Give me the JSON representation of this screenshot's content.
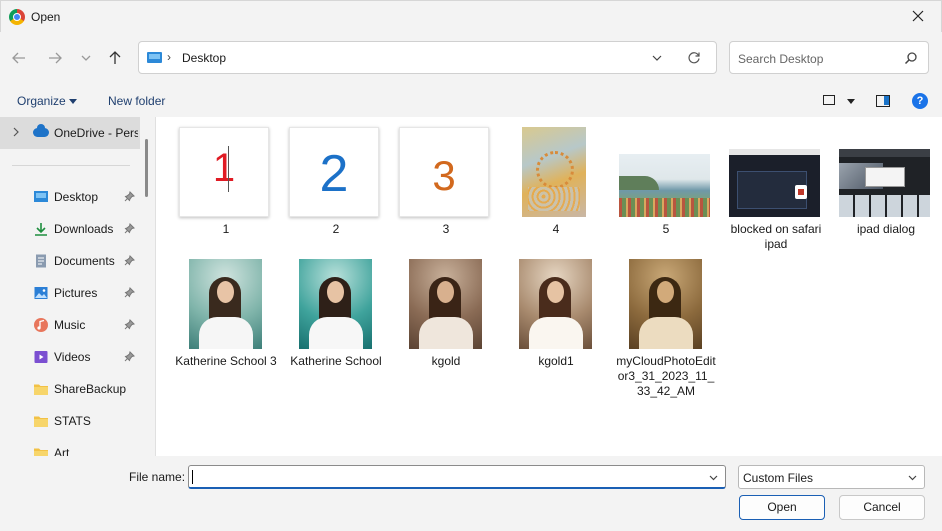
{
  "window": {
    "title": "Open"
  },
  "address": {
    "path": "Desktop"
  },
  "search": {
    "placeholder": "Search Desktop"
  },
  "commandbar": {
    "organize": "Organize",
    "new_folder": "New folder"
  },
  "sidebar": {
    "onedrive": "OneDrive - Perso",
    "items": [
      {
        "label": "Desktop",
        "icon": "desktop-icon"
      },
      {
        "label": "Downloads",
        "icon": "downloads-icon"
      },
      {
        "label": "Documents",
        "icon": "documents-icon"
      },
      {
        "label": "Pictures",
        "icon": "pictures-icon"
      },
      {
        "label": "Music",
        "icon": "music-icon"
      },
      {
        "label": "Videos",
        "icon": "videos-icon"
      },
      {
        "label": "ShareBackup",
        "icon": "folder-icon"
      },
      {
        "label": "STATS",
        "icon": "folder-icon"
      },
      {
        "label": "Art",
        "icon": "folder-icon"
      }
    ]
  },
  "files": {
    "row1": [
      {
        "name": "1",
        "glyph": "1",
        "color": "#e01b24"
      },
      {
        "name": "2",
        "glyph": "2",
        "color": "#1c71c8"
      },
      {
        "name": "3",
        "glyph": "3",
        "color": "#d2691e"
      },
      {
        "name": "4"
      },
      {
        "name": "5"
      },
      {
        "name": "blocked on safari ipad"
      },
      {
        "name": "ipad dialog"
      }
    ],
    "row2": [
      {
        "name": "Katherine School 3"
      },
      {
        "name": "Katherine School"
      },
      {
        "name": "kgold"
      },
      {
        "name": "kgold1"
      },
      {
        "name": "myCloudPhotoEditor3_31_2023_11_33_42_AM"
      }
    ]
  },
  "footer": {
    "file_name_label": "File name:",
    "file_name_value": "",
    "file_type": "Custom Files",
    "open": "Open",
    "cancel": "Cancel"
  }
}
